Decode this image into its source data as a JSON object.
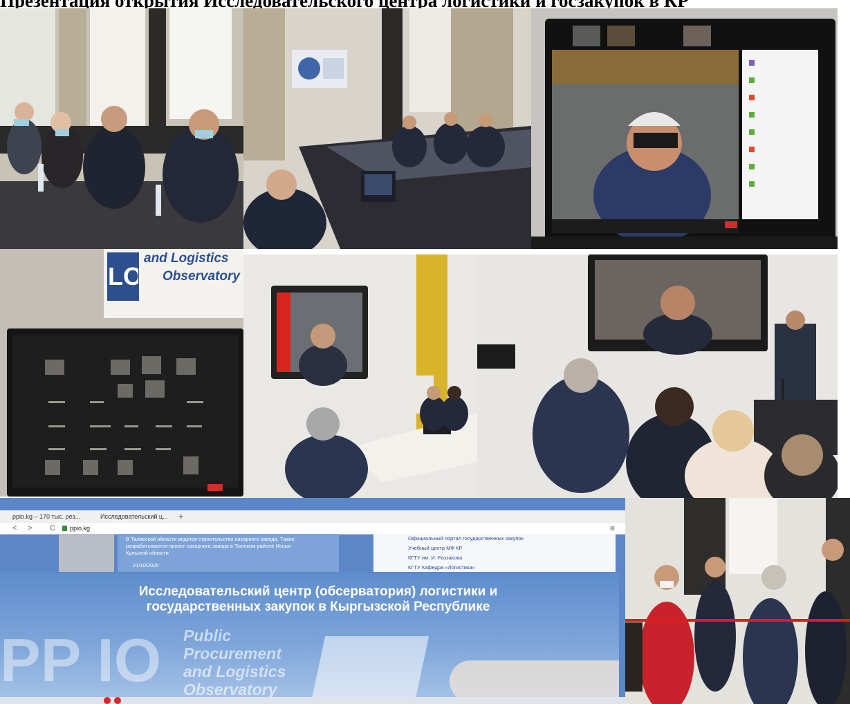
{
  "collage_title": "Презентация открытия Исследовательского центра логистики и госзакупок в КР",
  "photo4": {
    "sign_line1": "and Logistics",
    "sign_line2": "Observatory",
    "logo_mark": "LO"
  },
  "browser": {
    "tab1": "ppio.kg – 170 тыс. рез...",
    "tab2": "Исследовательский ц...",
    "url": "ppio.kg",
    "news_line1": "В Таласской области ведется строительство сахарного завода. Также",
    "news_line2": "разрабатывается проект сахарного завода в Тюпском районе Иссык-",
    "news_line3": "Кульской области",
    "news_date": "21/10/2020",
    "links": [
      "Официальный портал государственных закупок",
      "Учебный центр МФ КР",
      "КГТУ им. И. Раззакова",
      "КГТУ Кафедра «Логистика»"
    ],
    "hero_line1": "Исследовательский центр (обсерватория) логистики и",
    "hero_line2": "государственных закупок в Кыргызской Республике",
    "brand_line1": "Public",
    "brand_line2": "Procurement",
    "brand_line3": "and Logistics",
    "brand_line4": "Observatory",
    "big_letters": "PP IO"
  },
  "colors": {
    "hero_blue": "#5b86c8",
    "ribbon_red": "#d81e1e",
    "jacket_red": "#c8232c"
  }
}
